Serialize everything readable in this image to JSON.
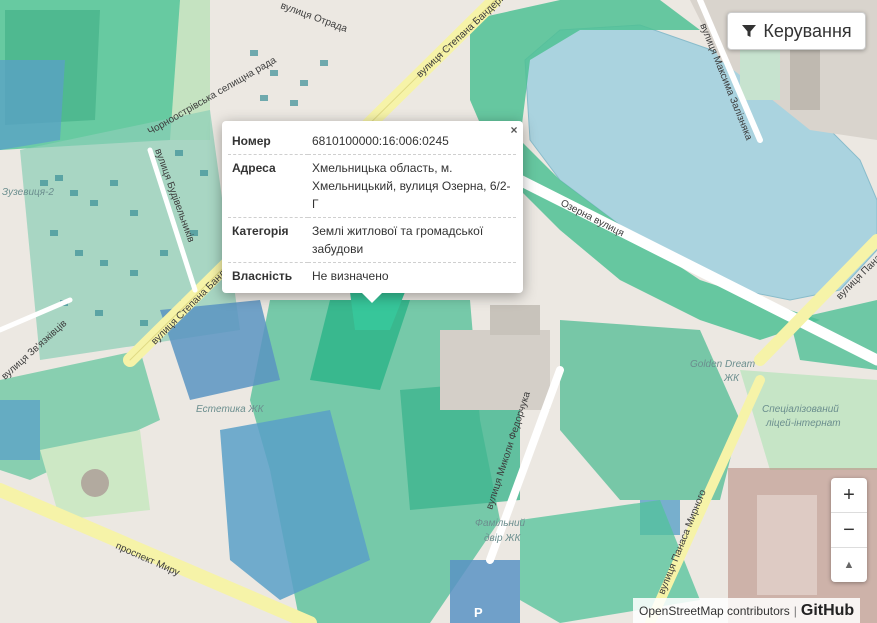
{
  "controls": {
    "button_label": "Керування",
    "button_icon": "filter-icon"
  },
  "popup": {
    "close_label": "×",
    "rows": [
      {
        "key": "Номер",
        "value": "6810100000:16:006:0245"
      },
      {
        "key": "Адреса",
        "value": "Хмельницька область, м. Хмельницький, вулиця Озерна, 6/2-Г"
      },
      {
        "key": "Категорія",
        "value": "Землі житлової та громадської забудови"
      },
      {
        "key": "Власність",
        "value": "Не визначено"
      }
    ]
  },
  "zoom": {
    "in": "+",
    "out": "−",
    "reset": "▲"
  },
  "attribution": {
    "osm": "OpenStreetMap contributors",
    "separator": "|",
    "github": "GitHub"
  },
  "map_labels": {
    "street_stepana_bandery_top": "вулиця Степана Бандери",
    "street_stepana_bandery_left": "вулиця Степана Бандери",
    "street_ozerna": "Озерна вулиця",
    "street_myru": "проспект Миру",
    "street_mykoly_fedorchuka": "вулиця Миколи Федорчука",
    "street_panasa_myrnoho": "вулиця Панаса Мирного",
    "street_panasa_right": "вулиця Панаса",
    "street_maksyma_zalizniaka": "вулиця Максима Залізняка",
    "street_zviazkivtsiv": "вулиця Зв'язківців",
    "street_budivelnykiv": "вулиця Будівельників",
    "street_otrada": "вулиця Отрада",
    "street_chornobyl": "Чорноострівська селищна рада",
    "poi_zuzevytsia": "Зузевиця-2",
    "poi_estetyka": "Естетика ЖК",
    "poi_golden_dream": "Golden Dream",
    "poi_golden_dream_2": "ЖК",
    "poi_lyceum": "Спеціалізований",
    "poi_lyceum_2": "ліцей-інтернат",
    "poi_familnyi": "Фамільний",
    "poi_familnyi_2": "двір ЖК",
    "poi_parking": "P"
  },
  "colors": {
    "parcel_green": "#41b88c",
    "parcel_light": "#7fd1b3",
    "parcel_blue": "#5aa0c8",
    "road_yellow": "#f6f3a8",
    "water": "#aad3df",
    "park": "#c9e8c0"
  }
}
